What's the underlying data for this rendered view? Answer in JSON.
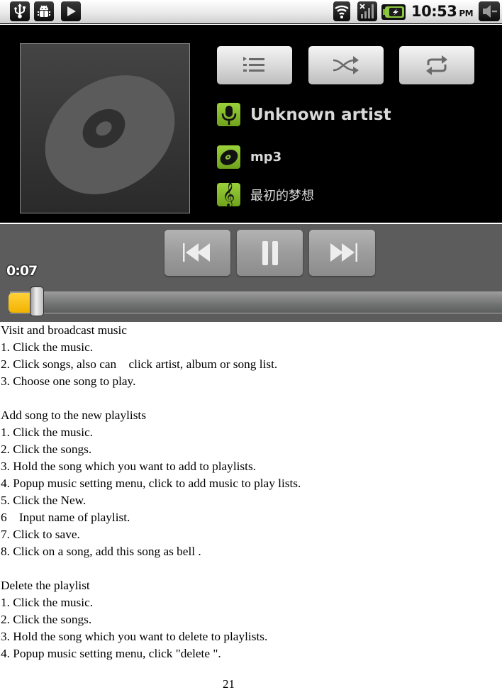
{
  "status_bar": {
    "left_icons": [
      "usb-icon",
      "android-debug-icon",
      "play-notification-icon"
    ],
    "right_icons": [
      "wifi-icon",
      "signal-no-data-icon",
      "battery-charging-icon"
    ],
    "time": "10:53",
    "ampm": "PM",
    "trailing_icon": "volume-icon"
  },
  "player": {
    "album_art_icon": "disc-icon",
    "buttons": {
      "playlist": "now-playing-list-icon",
      "shuffle": "shuffle-icon",
      "repeat": "repeat-icon"
    },
    "artist": "Unknown artist",
    "album": "mp3",
    "track": "最初的梦想",
    "elapsed": "0:07",
    "progress_fraction": 0.035,
    "transport": {
      "prev": "previous-icon",
      "pause": "pause-icon",
      "next": "next-icon"
    },
    "accent_color": "#f2b200",
    "info_icon_color": "#8cc63f"
  },
  "document": {
    "sections": [
      {
        "title": "Visit and broadcast music",
        "steps": [
          "1. Click the music.",
          "2. Click songs, also can    click artist, album or song list.",
          "3. Choose one song to play."
        ]
      },
      {
        "title": "Add song to the new playlists",
        "steps": [
          "1. Click the music.",
          "2. Click the songs.",
          "3. Hold the song which you want to add to playlists.",
          "4. Popup music setting menu, click to add music to play lists.",
          "5. Click the New.",
          "6    Input name of playlist.",
          "7. Click to save.",
          "8. Click on a song, add this song as bell ."
        ]
      },
      {
        "title": "Delete the playlist",
        "steps": [
          "1. Click the music.",
          "2. Click the songs.",
          "3. Hold the song which you want to delete to playlists.",
          "4. Popup music setting menu, click \"delete \"."
        ]
      }
    ],
    "page_number": "21"
  }
}
